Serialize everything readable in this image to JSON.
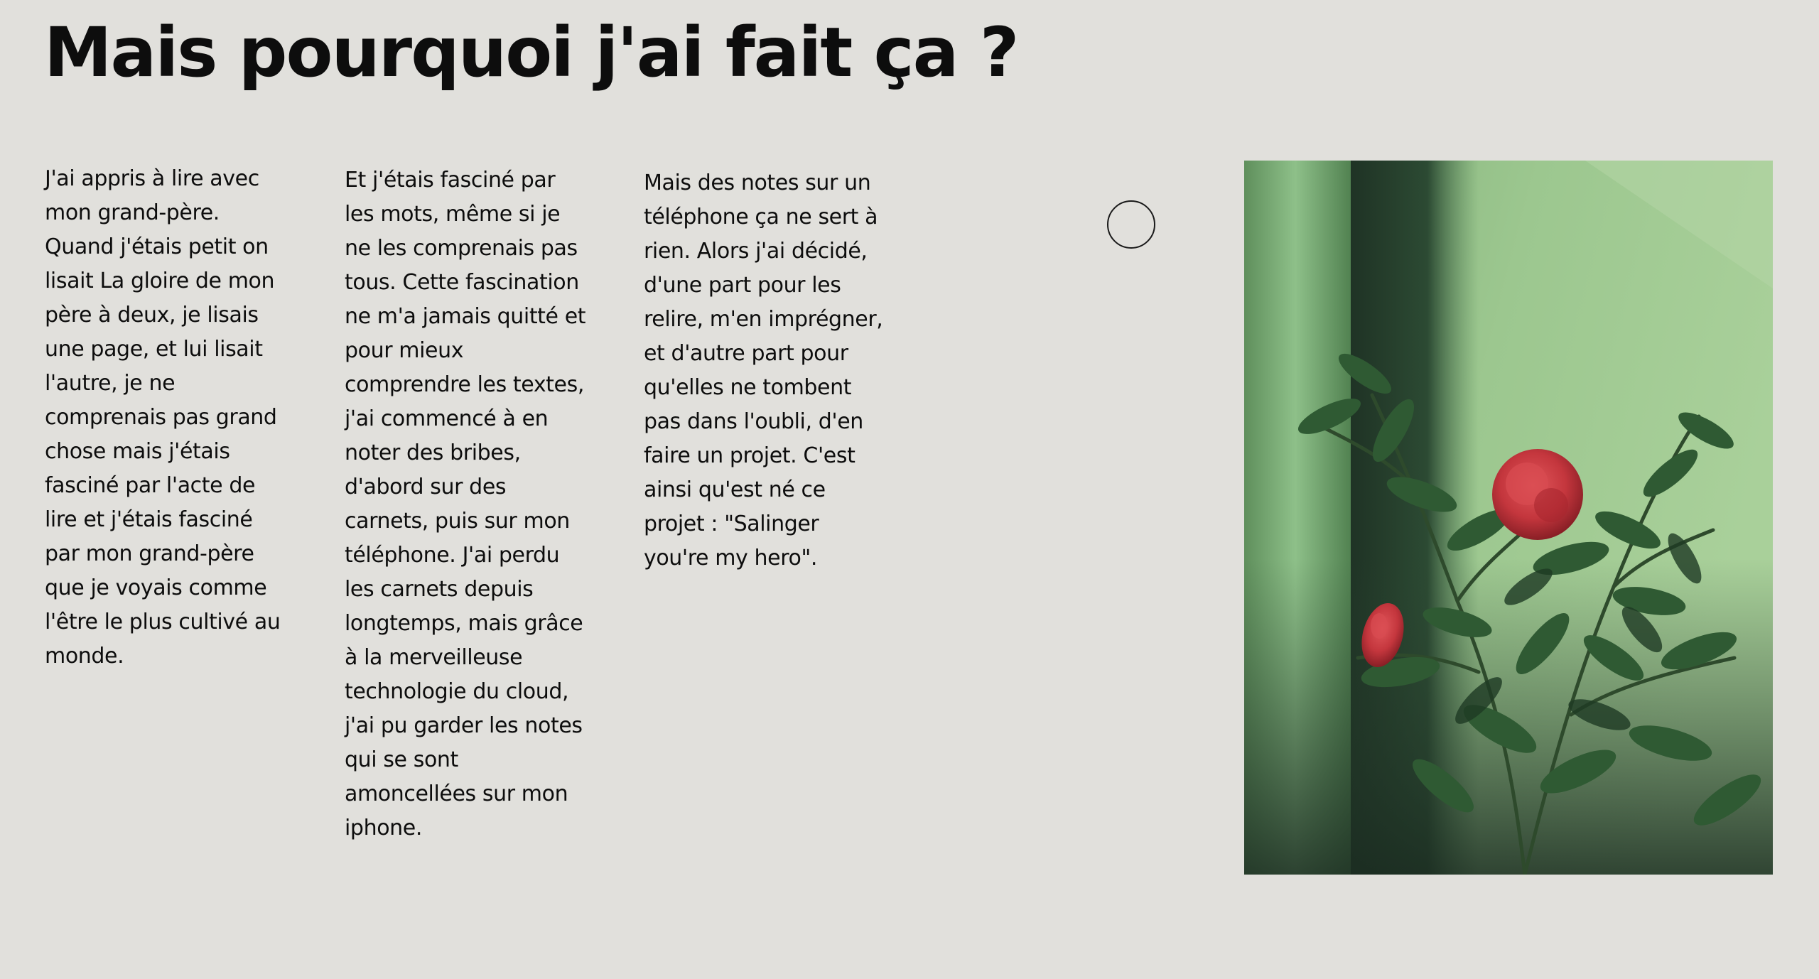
{
  "page": {
    "title": "Mais pourquoi j'ai fait ça ?"
  },
  "columns": [
    {
      "text": "J'ai appris à lire avec mon grand-père. Quand j'étais petit on lisait La gloire de mon père à deux, je lisais une page, et lui lisait l'autre, je ne comprenais pas grand chose mais j'étais fasciné par l'acte de lire et j'étais fasciné par mon grand-père que je voyais comme l'être le plus cultivé au monde."
    },
    {
      "text": "Et j'étais fasciné par les mots, même si je ne les comprenais pas tous. Cette fascination ne m'a jamais quitté et pour mieux comprendre les textes, j'ai commencé à en noter des bribes, d'abord sur des carnets, puis sur mon téléphone. J'ai perdu les carnets depuis longtemps, mais grâce à la merveilleuse technologie du cloud, j'ai pu garder les notes qui se sont amoncellées sur mon iphone."
    },
    {
      "text": "Mais des notes sur un téléphone ça ne sert à rien. Alors j'ai décidé, d'une part pour les relire, m'en imprégner, et d'autre part pour qu'elles ne tombent pas dans l'oubli, d'en faire un projet. C'est ainsi qu'est né ce projet : \"Salinger you're my hero\"."
    }
  ],
  "image": {
    "icon": "camellia-flower-photo"
  },
  "colors": {
    "background": "#e1e0dc",
    "text": "#0d0d0d",
    "photo_green": "#8fbf86",
    "flower_red": "#c8373d"
  }
}
